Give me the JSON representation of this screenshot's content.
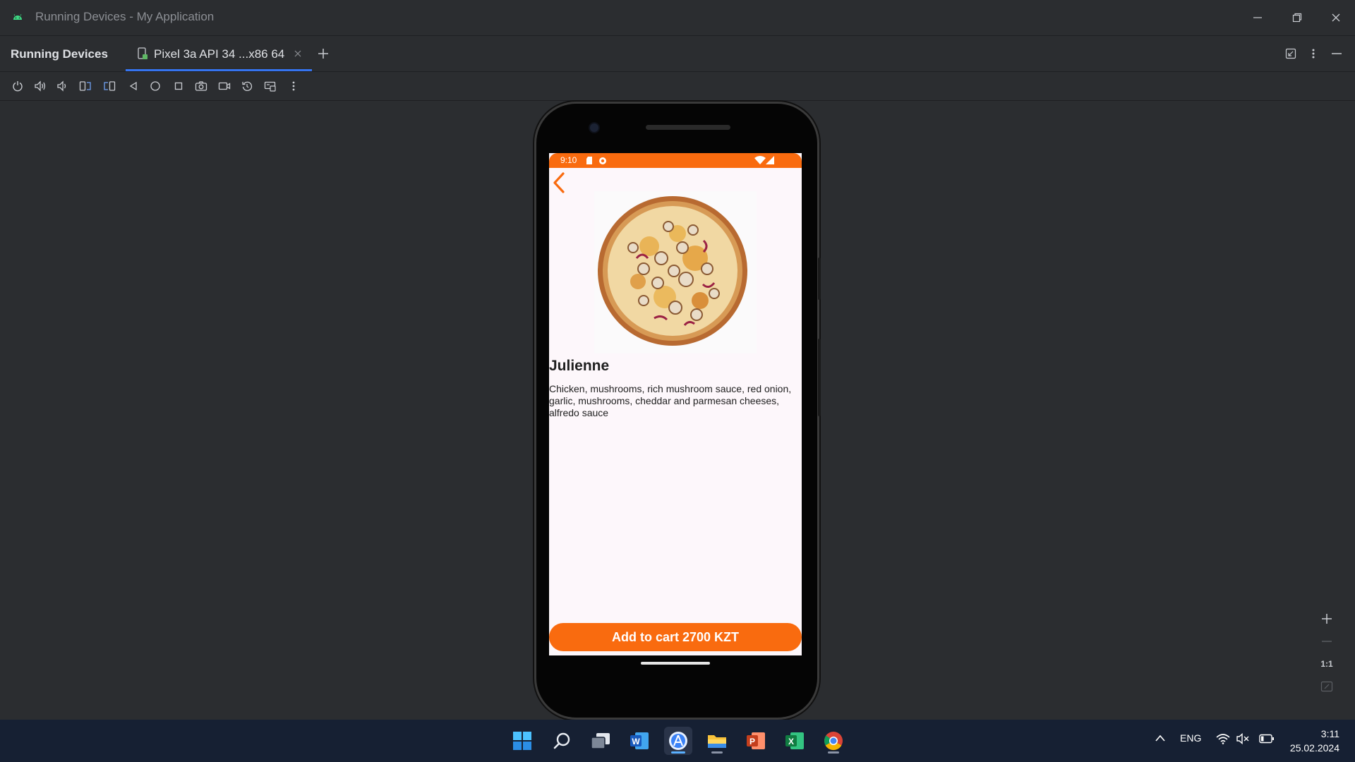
{
  "window": {
    "title": "Running Devices - My Application",
    "icon": "android-icon",
    "controls": [
      "minimize-icon",
      "restore-icon",
      "close-icon"
    ]
  },
  "panel": {
    "title": "Running Devices",
    "device_tab_label": "Pixel 3a API 34 ...x86 64",
    "add_tab_icon": "plus-icon",
    "right_icons": [
      "collapse-icon",
      "more-vertical-icon",
      "minimize-panel-icon"
    ]
  },
  "toolbar": {
    "icons": [
      "power-icon",
      "volume-up-icon",
      "volume-down-icon",
      "rotate-left-icon",
      "rotate-right-icon",
      "back-icon",
      "home-icon",
      "overview-icon",
      "camera-icon",
      "record-icon",
      "reset-icon",
      "keyboard-icon",
      "more-icon"
    ]
  },
  "phone": {
    "status_time": "9:10",
    "status_icons": [
      "sd-card-icon",
      "notification-icon",
      "wifi-icon",
      "signal-icon"
    ],
    "accent_color": "#f96b0f",
    "product": {
      "name": "Julienne",
      "description": "Chicken, mushrooms, rich mushroom sauce, red onion, garlic, mushrooms, cheddar and parmesan cheeses, alfredo sauce",
      "cart_button": "Add to cart 2700 KZT"
    }
  },
  "zoom": {
    "zoom_in": "+",
    "zoom_out": "—",
    "actual_size": "1:1",
    "fit_icon": "fit-screen-icon"
  },
  "taskbar": {
    "apps": [
      "windows-start-icon",
      "search-icon",
      "task-view-icon",
      "word-icon",
      "android-studio-icon",
      "file-explorer-icon",
      "powerpoint-icon",
      "excel-icon",
      "chrome-icon"
    ],
    "language": "ENG",
    "time": "3:11",
    "date": "25.02.2024"
  }
}
